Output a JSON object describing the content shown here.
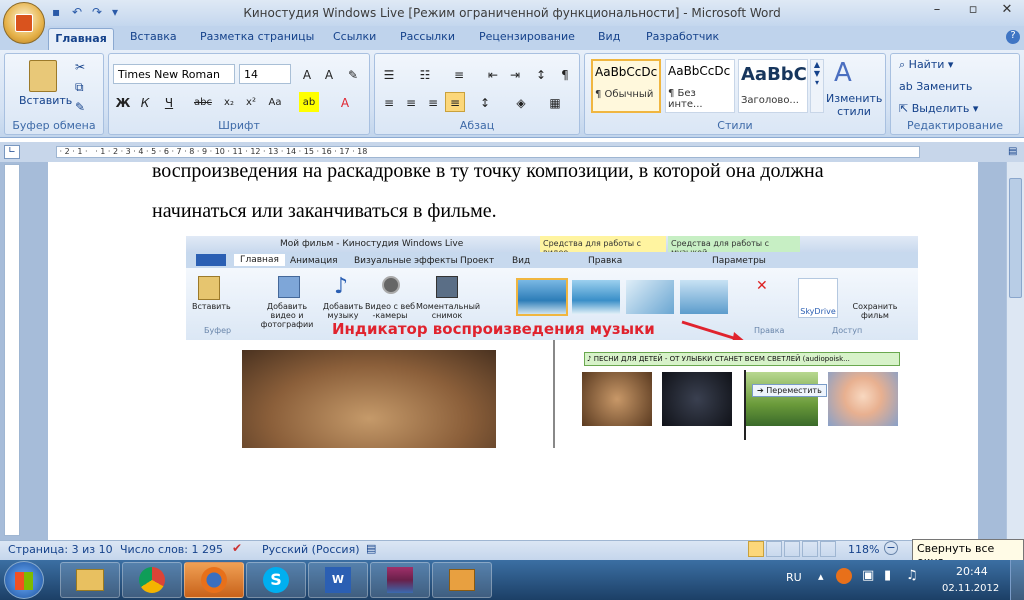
{
  "window": {
    "title": "Киностудия Windows Live [Режим ограниченной функциональности] - Microsoft Word"
  },
  "tabs": [
    "Главная",
    "Вставка",
    "Разметка страницы",
    "Ссылки",
    "Рассылки",
    "Рецензирование",
    "Вид",
    "Разработчик"
  ],
  "clipboard": {
    "paste": "Вставить",
    "group": "Буфер обмена"
  },
  "font": {
    "name": "Times New Roman",
    "size": "14",
    "group": "Шрифт"
  },
  "paragraph": {
    "group": "Абзац"
  },
  "styles": {
    "group": "Стили",
    "items": [
      {
        "preview": "AaBbCcDc",
        "name": "¶ Обычный"
      },
      {
        "preview": "AaBbCcDc",
        "name": "¶ Без инте..."
      },
      {
        "preview": "AaBbC",
        "name": "Заголово..."
      }
    ],
    "change": "Изменить стили"
  },
  "editing": {
    "group": "Редактирование",
    "find": "Найти",
    "replace": "Заменить",
    "select": "Выделить"
  },
  "document": {
    "line1": "воспроизведения на раскадровке в ту точку композиции, в которой она должна",
    "line2": "начинаться или заканчиваться в фильме."
  },
  "embedded": {
    "title": "Мой фильм - Киностудия Windows Live",
    "ctx_video": "Средства для работы с видео",
    "ctx_music": "Средства для работы с музыкой",
    "edit": "Правка",
    "params": "Параметры",
    "tabs": [
      "Главная",
      "Анимация",
      "Визуальные эффекты",
      "Проект",
      "Вид"
    ],
    "paste": "Вставить",
    "buffer": "Буфер",
    "add_video": "Добавить видео и фотографии",
    "add_music": "Добавить музыку",
    "webcam": "Видео с веб -камеры",
    "snapshot": "Моментальный снимок",
    "skydrive": "SkyDrive",
    "save": "Сохранить фильм",
    "edit2": "Правка",
    "access": "Доступ",
    "annotation": "Индикатор воспроизведения музыки",
    "song": "♪ ПЕСНИ ДЛЯ ДЕТЕЙ - ОТ УЛЫБКИ СТАНЕТ ВСЕМ СВЕТЛЕЙ  (audiopoisk...",
    "move": "Переместить"
  },
  "status": {
    "page": "Страница: 3 из 10",
    "words": "Число слов: 1 295",
    "lang": "Русский (Россия)",
    "zoom": "118%",
    "tooltip": "Свернуть все окна"
  },
  "tray": {
    "lang": "RU",
    "time": "20:44",
    "date": "02.11.2012"
  },
  "colors": {
    "annotation": "#e0232e",
    "ribbon": "#dbe6f4"
  }
}
